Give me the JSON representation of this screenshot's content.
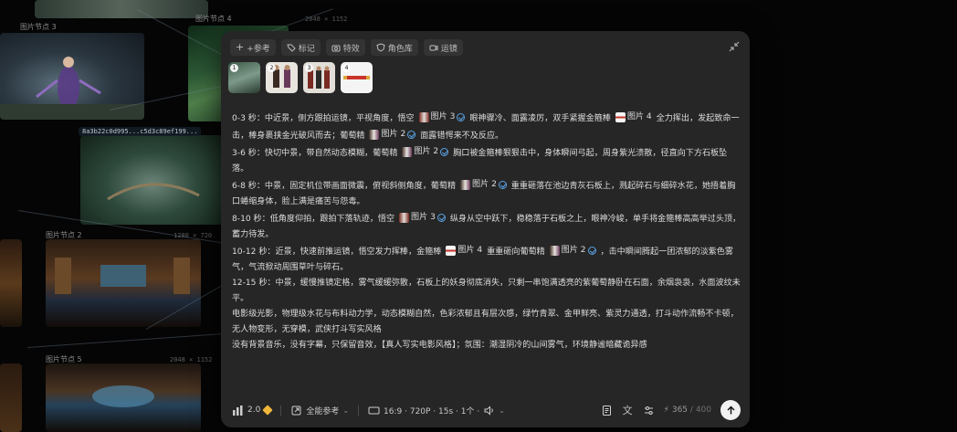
{
  "canvas": {
    "node_hash": "8a3b22c0d995...c5d3c89ef199...",
    "labels": {
      "node_a": "图片节点 3",
      "node_b": "图片节点 4",
      "node_c": "图片节点 2",
      "node_d": "图片节点 5"
    },
    "sizes": {
      "s1": "2048 × 1152",
      "s2": "1280 × 720",
      "s3": "2048 × 1152"
    }
  },
  "toolbar": {
    "items": [
      {
        "label": "+参考",
        "icon": "plus-icon"
      },
      {
        "label": "标记",
        "icon": "tag-icon"
      },
      {
        "label": "特效",
        "icon": "camera-icon"
      },
      {
        "label": "角色库",
        "icon": "shield-icon"
      },
      {
        "label": "运镜",
        "icon": "video-icon"
      }
    ],
    "collapse_icon": "collapse-icon"
  },
  "thumbnails": [
    {
      "num": "1",
      "name": "forest-river"
    },
    {
      "num": "2",
      "name": "characters-pair"
    },
    {
      "num": "3",
      "name": "characters-trio"
    },
    {
      "num": "4",
      "name": "staff-weapon"
    }
  ],
  "prompt": {
    "p1": {
      "a": "0-3 秒：中近景，侧方跟拍运镜，平视角度，悟空",
      "r1": "图片 3",
      "b": "眼神骤冷、面露凌厉，双手紧握金箍棒",
      "r2": "图片 4",
      "c": "全力挥出，发起致命一击，棒身裹挟金光破风而去；葡萄精",
      "r3": "图片 2",
      "d": "面露错愕来不及反应。"
    },
    "p2": {
      "a": "3-6 秒：快切中景，带自然动态模糊，葡萄精",
      "r1": "图片 2",
      "b": "胸口被金箍棒狠狠击中，身体瞬间弓起，周身紫光溃散，径直向下方石板坠落。"
    },
    "p3": {
      "a": "6-8 秒：中景，固定机位带画面微震，俯视斜侧角度，葡萄精",
      "r1": "图片 2",
      "b": "重重砸落在池边青灰石板上，溅起碎石与细碎水花，她捂着胸口蜷缩身体，脸上满是痛苦与怨毒。"
    },
    "p4": {
      "a": "8-10 秒：低角度仰拍，跟拍下落轨迹，悟空",
      "r1": "图片 3",
      "b": "纵身从空中跃下，稳稳落于石板之上，眼神冷峻，单手将金箍棒高高举过头顶，蓄力待发。"
    },
    "p5": {
      "a": "10-12 秒：近景，快速前推运镜，悟空发力挥棒，金箍棒",
      "r1": "图片 4",
      "b": "重重砸向葡萄精",
      "r2": "图片 2",
      "c": "，击中瞬间腾起一团浓郁的淡紫色雾气，气流掀动周围草叶与碎石。"
    },
    "p6": "12-15 秒：中景，缓慢推镜定格，雾气缓缓弥散，石板上的妖身彻底消失，只剩一串饱满透亮的紫葡萄静卧在石面，余烟袅袅，水面波纹未平。",
    "p7": "电影级光影，物理级水花与布料动力学，动态模糊自然，色彩浓郁且有层次感，绿竹青翠、金甲鲜亮、紫灵力通透，打斗动作流畅不卡顿，无人物变形，无穿模，武侠打斗写实风格",
    "p8": "没有背景音乐，没有字幕，只保留音效，【真人写实电影风格】；氛围：潮湿阴冷的山间雾气，环境静谧暗藏诡异感"
  },
  "bottom": {
    "model": "2.0",
    "reference": "全能参考",
    "specs": "16:9 · 720P · 15s · 1个 ·",
    "count_used": "365",
    "count_total": "/ 400"
  },
  "colors": {
    "panel": "#262626",
    "accent_check": "#5aa3e6",
    "gem": "#f0b53a"
  }
}
